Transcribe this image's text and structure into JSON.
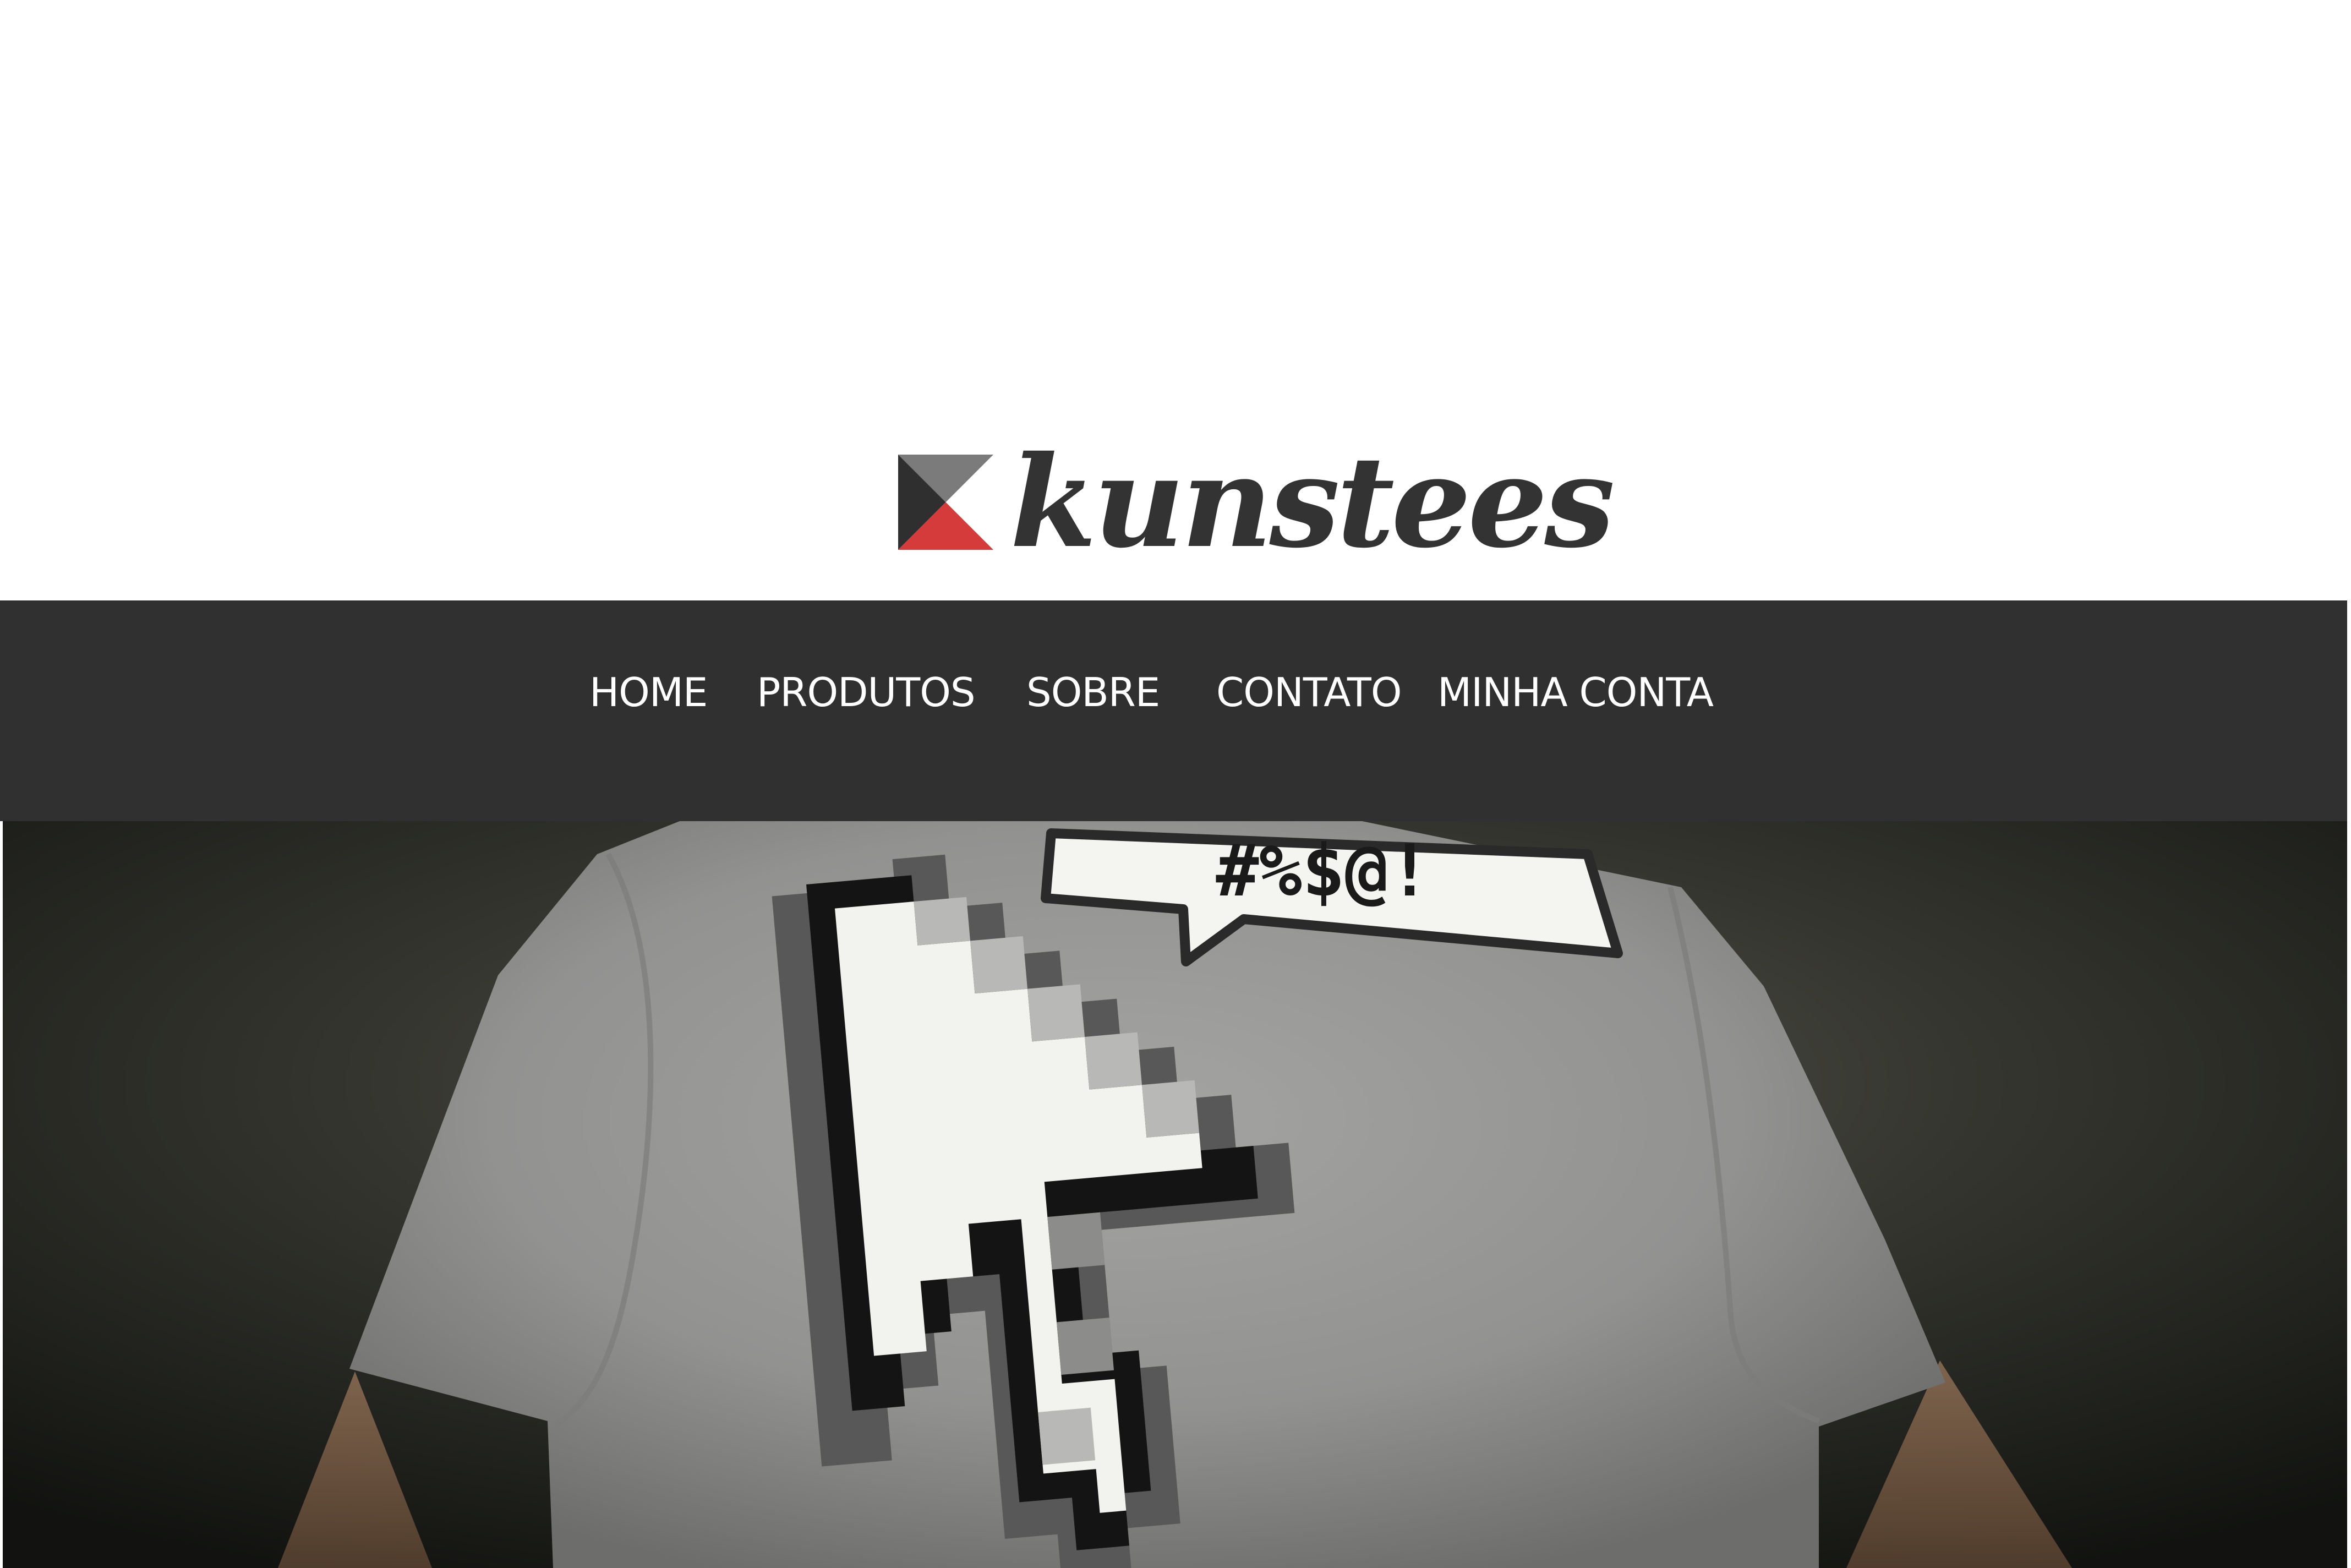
{
  "brand": {
    "name": "kunstees",
    "logo_icon": "kunstees-logo-mark",
    "colors": {
      "mark_gray": "#7b7b7b",
      "mark_dark": "#2f2f2f",
      "mark_red": "#d63b3b",
      "wordmark": "#333333"
    }
  },
  "nav": {
    "background": "#303030",
    "items": [
      {
        "key": "home",
        "label": "HOME"
      },
      {
        "key": "produtos",
        "label": "PRODUTOS"
      },
      {
        "key": "sobre",
        "label": "SOBRE"
      },
      {
        "key": "contato",
        "label": "CONTATO"
      },
      {
        "key": "minha-conta",
        "label": "MINHA CONTA"
      }
    ]
  },
  "hero": {
    "image": "gray t-shirt with pixel arrow cursor and speech bubble print",
    "speech_bubble_text": "#%$@!"
  }
}
